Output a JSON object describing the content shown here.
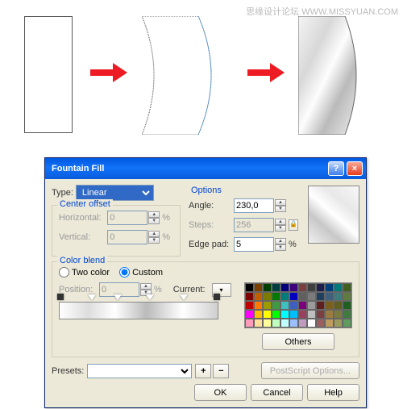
{
  "watermark": "思缘设计论坛  WWW.MISSYUAN.COM",
  "dialog": {
    "title": "Fountain Fill",
    "close": "×",
    "help": "?",
    "type_label": "Type:",
    "type_value": "Linear",
    "center_offset": {
      "legend": "Center offset",
      "h_label": "Horizontal:",
      "h_value": "0",
      "v_label": "Vertical:",
      "v_value": "0",
      "pct": "%"
    },
    "options": {
      "legend": "Options",
      "angle_label": "Angle:",
      "angle_value": "230,0",
      "steps_label": "Steps:",
      "steps_value": "256",
      "edge_label": "Edge pad:",
      "edge_value": "5",
      "pct": "%"
    },
    "color_blend": {
      "legend": "Color blend",
      "two_color": "Two color",
      "custom": "Custom",
      "position_label": "Position:",
      "position_value": "0",
      "pct": "%",
      "current_label": "Current:",
      "others": "Others"
    },
    "presets_label": "Presets:",
    "postscript": "PostScript Options...",
    "ok": "OK",
    "cancel": "Cancel",
    "help_btn": "Help"
  },
  "palette": [
    "#000",
    "#7b3f00",
    "#003f00",
    "#003f3f",
    "#00007b",
    "#3f007b",
    "#7b3f3f",
    "#3f3f3f",
    "#1f1f4f",
    "#003f7b",
    "#007b7b",
    "#3f5f1f",
    "#7b0000",
    "#bf5f00",
    "#7b7b00",
    "#007b00",
    "#007b7b",
    "#0000bf",
    "#5f5f5f",
    "#7b7b7b",
    "#1f3f5f",
    "#3f5f7b",
    "#3f7b7b",
    "#5f7b3f",
    "#bf0000",
    "#ff7b00",
    "#9b9b00",
    "#3f9b3f",
    "#3fbfbf",
    "#3f5fbf",
    "#7b007b",
    "#9b9b9b",
    "#5f1f1f",
    "#7b5f1f",
    "#5f5f1f",
    "#1f5f1f",
    "#ff00ff",
    "#ffbf00",
    "#ffff00",
    "#00ff00",
    "#00ffff",
    "#00bfff",
    "#9b3f5f",
    "#bfbfbf",
    "#7b3f3f",
    "#9b7b3f",
    "#7b7b3f",
    "#3f7b3f",
    "#ff9bbb",
    "#ffdf9b",
    "#ffff9b",
    "#bfffbf",
    "#bfffff",
    "#9bbfff",
    "#bf9bbf",
    "#fff",
    "#9b5f5f",
    "#bf9b5f",
    "#9b9b5f",
    "#5f9b5f"
  ]
}
